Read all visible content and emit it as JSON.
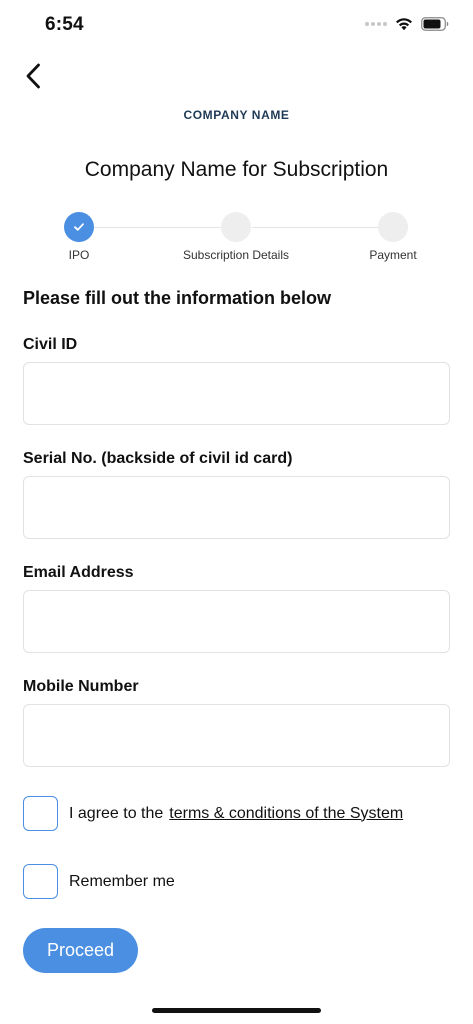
{
  "status_bar": {
    "time": "6:54",
    "icons": [
      "signal-dots-icon",
      "wifi-icon",
      "battery-icon"
    ]
  },
  "header": {
    "back_icon": "chevron-left-icon",
    "company_name": "COMPANY NAME",
    "title": "Company Name for Subscription"
  },
  "stepper": {
    "steps": [
      {
        "label": "IPO",
        "state": "completed",
        "icon": "checkmark-icon"
      },
      {
        "label": "Subscription Details",
        "state": "pending"
      },
      {
        "label": "Payment",
        "state": "pending"
      }
    ]
  },
  "form": {
    "heading": "Please fill out the information below",
    "fields": [
      {
        "label": "Civil ID",
        "value": ""
      },
      {
        "label": "Serial No. (backside of civil id card)",
        "value": ""
      },
      {
        "label": "Email Address",
        "value": ""
      },
      {
        "label": "Mobile Number",
        "value": ""
      }
    ],
    "agree": {
      "text": "I agree to the",
      "link": "terms & conditions of the System",
      "checked": false
    },
    "remember": {
      "text": "Remember me",
      "checked": false
    },
    "proceed_label": "Proceed"
  },
  "colors": {
    "accent": "#4a8fe2",
    "step_pending": "#eeeeee",
    "border": "#e2e2e2",
    "company_name": "#1f3a55"
  }
}
